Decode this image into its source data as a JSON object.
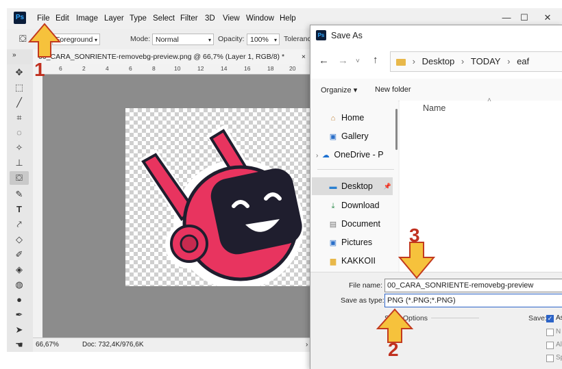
{
  "ps": {
    "logo": "Ps",
    "menu": [
      "File",
      "Edit",
      "Image",
      "Layer",
      "Type",
      "Select",
      "Filter",
      "3D",
      "View",
      "Window",
      "Help"
    ],
    "window_buttons": [
      "—",
      "☐",
      "✕"
    ],
    "options": {
      "fill_source": "Foreground",
      "mode_label": "Mode:",
      "mode_value": "Normal",
      "opacity_label": "Opacity:",
      "opacity_value": "100%",
      "tolerance_label": "Toleranc"
    },
    "tab_prefix": "»",
    "doc_tab": "00_CARA_SONRIENTE-removebg-preview.png @ 66,7% (Layer 1, RGB/8) *",
    "doc_tab_close": "×",
    "ruler_ticks": [
      "6",
      "2",
      "4",
      "6",
      "8",
      "10",
      "12",
      "14",
      "16",
      "18",
      "20",
      "22"
    ],
    "status_zoom": "66,67%",
    "status_doc": "Doc: 732,4K/976,6K",
    "status_arrow": "›"
  },
  "dialog": {
    "logo": "Ps",
    "title": "Save As",
    "close": "✕",
    "breadcrumb": [
      "Desktop",
      "TODAY",
      "eaf"
    ],
    "organize": "Organize ▾",
    "new_folder": "New folder",
    "column_name": "Name",
    "sidebar": [
      {
        "label": "Home",
        "icon": "home-icon"
      },
      {
        "label": "Gallery",
        "icon": "gallery-icon"
      },
      {
        "label": "OneDrive - P",
        "icon": "cloud-icon"
      },
      {
        "label": "Desktop",
        "icon": "desktop-icon"
      },
      {
        "label": "Download",
        "icon": "download-icon"
      },
      {
        "label": "Document",
        "icon": "document-icon"
      },
      {
        "label": "Pictures",
        "icon": "pictures-icon"
      },
      {
        "label": "KAKKOII",
        "icon": "folder-icon"
      }
    ],
    "file_name_label": "File name:",
    "file_name_value": "00_CARA_SONRIENTE-removebg-preview",
    "save_type_label": "Save as type:",
    "save_type_value": "PNG (*.PNG;*.PNG)",
    "save_options": "Save Options",
    "save_label": "Save:",
    "checkbox_labels": [
      "As",
      "N",
      "Al",
      "Sp"
    ]
  },
  "annotations": [
    "1",
    "2",
    "3"
  ],
  "colors": {
    "arrow_fill": "#f6c23c",
    "arrow_stroke": "#c23a1e",
    "robot_pink": "#e8345f",
    "robot_dark": "#1f1e2e"
  }
}
